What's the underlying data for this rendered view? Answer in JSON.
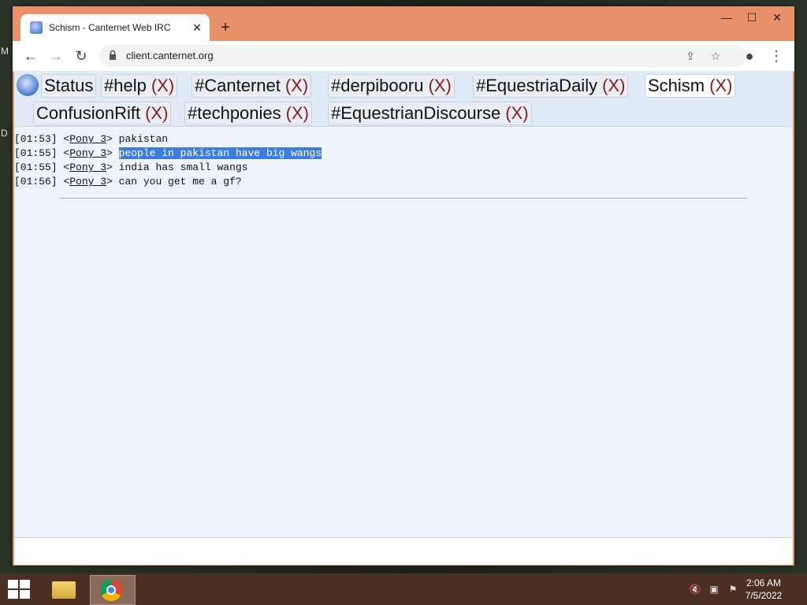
{
  "browser": {
    "tab_title": "Schism - Canternet Web IRC",
    "new_tab_label": "+",
    "tab_close_label": "✕",
    "url": "client.canternet.org",
    "window_controls": {
      "minimize": "—",
      "maximize": "☐",
      "close": "✕"
    },
    "icons": [
      "back-icon",
      "forward-icon",
      "reload-icon",
      "lock-icon",
      "share-icon",
      "star-icon",
      "profile-icon",
      "menu-icon"
    ]
  },
  "desktop": {
    "left_letters": [
      "M",
      "D"
    ]
  },
  "irc": {
    "channels": [
      {
        "name": "Status",
        "close": ""
      },
      {
        "name": "#help",
        "close": "(X)"
      },
      {
        "name": "#Canternet",
        "close": "(X)"
      },
      {
        "name": "#derpibooru",
        "close": "(X)"
      },
      {
        "name": "#EquestriaDaily",
        "close": "(X)"
      },
      {
        "name": "Schism",
        "close": "(X)",
        "active": true
      },
      {
        "name": "ConfusionRift",
        "close": "(X)"
      },
      {
        "name": "#techponies",
        "close": "(X)"
      },
      {
        "name": "#EquestrianDiscourse",
        "close": "(X)"
      }
    ],
    "messages": [
      {
        "time": "[01:53]",
        "nick": "Pony_3",
        "text": "pakistan"
      },
      {
        "time": "[01:55]",
        "nick": "Pony_3",
        "text": "people in pakistan have big wangs",
        "selected": true
      },
      {
        "time": "[01:55]",
        "nick": "Pony_3",
        "text": "india has small wangs"
      },
      {
        "time": "[01:56]",
        "nick": "Pony_3",
        "text": "can you get me a gf?"
      }
    ],
    "input_value": ""
  },
  "taskbar": {
    "clock_time": "2:06 AM",
    "clock_date": "7/5/2022",
    "apps": [
      "file-explorer-icon",
      "chrome-icon"
    ]
  },
  "colors": {
    "window_frame": "#e8906a",
    "close_x": "#8b1a1a",
    "selection": "#3b7de0",
    "taskbar": "#4a2f22"
  }
}
